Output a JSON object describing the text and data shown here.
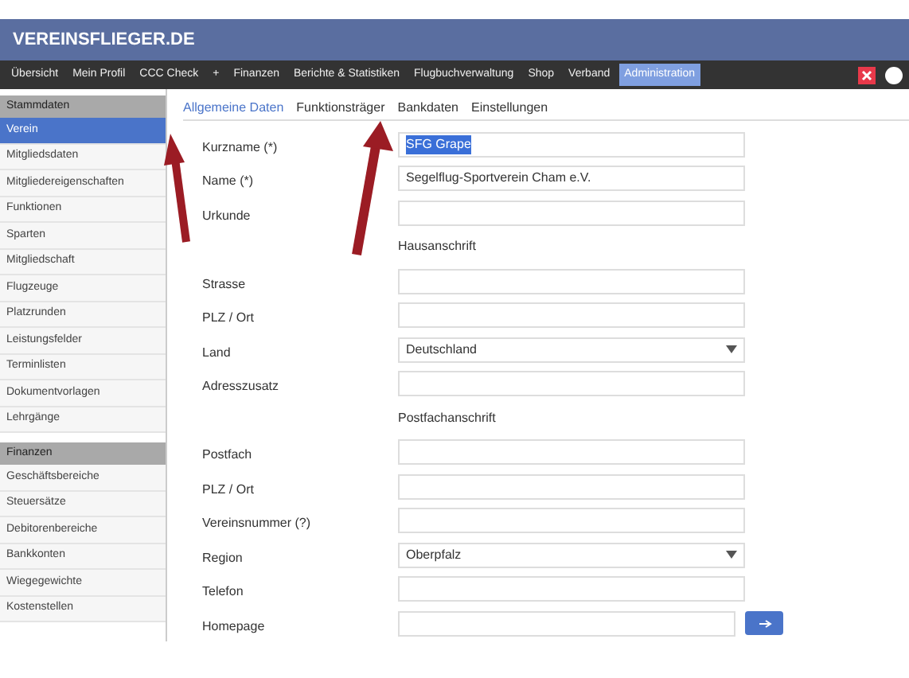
{
  "header": {
    "title": "VEREINSFLIEGER.DE"
  },
  "nav": [
    {
      "label": "Übersicht",
      "selected": false
    },
    {
      "label": "Mein Profil",
      "selected": false
    },
    {
      "label": "CCC Check",
      "selected": false
    },
    {
      "label": "+",
      "selected": false
    },
    {
      "label": "Finanzen",
      "selected": false
    },
    {
      "label": "Berichte & Statistiken",
      "selected": false
    },
    {
      "label": "Flugbuchverwaltung",
      "selected": false
    },
    {
      "label": "Shop",
      "selected": false
    },
    {
      "label": "Verband",
      "selected": false
    },
    {
      "label": "Administration",
      "selected": true
    }
  ],
  "sidebar": [
    {
      "title": "Stammdaten",
      "items": [
        {
          "label": "Verein",
          "selected": true
        },
        {
          "label": "Mitgliedsdaten",
          "selected": false
        },
        {
          "label": "Mitgliedereigenschaften",
          "selected": false
        },
        {
          "label": "Funktionen",
          "selected": false
        },
        {
          "label": "Sparten",
          "selected": false
        },
        {
          "label": "Mitgliedschaft",
          "selected": false
        },
        {
          "label": "Flugzeuge",
          "selected": false
        },
        {
          "label": "Platzrunden",
          "selected": false
        },
        {
          "label": "Leistungsfelder",
          "selected": false
        },
        {
          "label": "Terminlisten",
          "selected": false
        },
        {
          "label": "Dokumentvorlagen",
          "selected": false
        },
        {
          "label": "Lehrgänge",
          "selected": false
        }
      ]
    },
    {
      "title": "Finanzen",
      "items": [
        {
          "label": "Geschäftsbereiche",
          "selected": false
        },
        {
          "label": "Steuersätze",
          "selected": false
        },
        {
          "label": "Debitorenbereiche",
          "selected": false
        },
        {
          "label": "Bankkonten",
          "selected": false
        },
        {
          "label": "Wiegegewichte",
          "selected": false
        },
        {
          "label": "Kostenstellen",
          "selected": false
        }
      ]
    }
  ],
  "tabs": [
    {
      "label": "Allgemeine Daten",
      "selected": true
    },
    {
      "label": "Funktionsträger",
      "selected": false
    },
    {
      "label": "Bankdaten",
      "selected": false
    },
    {
      "label": "Einstellungen",
      "selected": false
    }
  ],
  "form": [
    {
      "kind": "input",
      "label": "Kurzname (*)",
      "value": "SFG Grape",
      "highlighted": true
    },
    {
      "kind": "input",
      "label": "Name (*)",
      "value": "Segelflug-Sportverein Cham e.V.",
      "highlighted": false
    },
    {
      "kind": "input",
      "label": "Urkunde"
    },
    {
      "kind": "heading",
      "text": "Hausanschrift"
    },
    {
      "kind": "input",
      "label": "Strasse"
    },
    {
      "kind": "input",
      "label": "PLZ / Ort"
    },
    {
      "kind": "select",
      "label": "Land",
      "value": "Deutschland"
    },
    {
      "kind": "input",
      "label": "Adresszusatz"
    },
    {
      "kind": "heading",
      "text": "Postfachanschrift"
    },
    {
      "kind": "input",
      "label": "Postfach"
    },
    {
      "kind": "input",
      "label": "PLZ / Ort"
    },
    {
      "kind": "input",
      "label": "Vereinsnummer (?)"
    },
    {
      "kind": "select",
      "label": "Region",
      "value": "Oberpfalz"
    },
    {
      "kind": "input",
      "label": "Telefon"
    },
    {
      "kind": "link",
      "label": "Homepage"
    }
  ]
}
